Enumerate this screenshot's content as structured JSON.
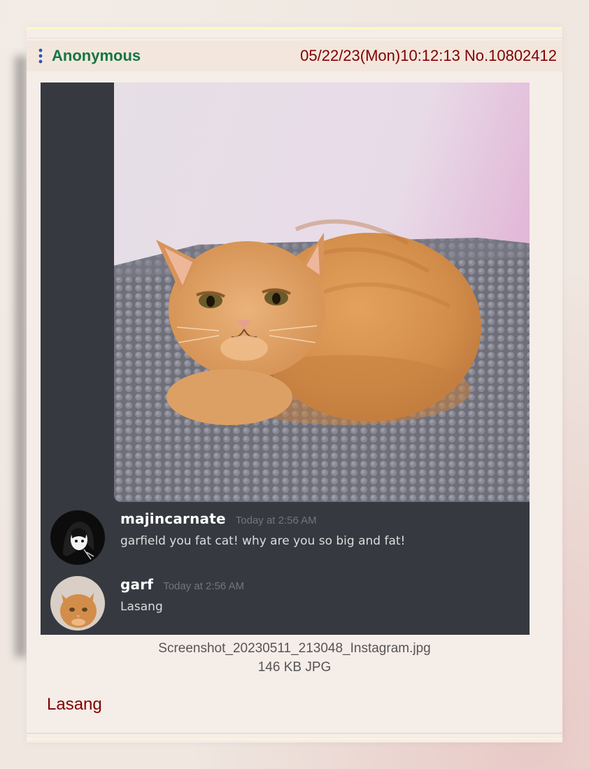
{
  "post": {
    "author": "Anonymous",
    "datetime": "05/22/23(Mon)10:12:13",
    "number": "No.10802412",
    "comment": "Lasang",
    "menu_icon": "vertical-ellipsis-icon"
  },
  "attachment": {
    "filename": "Screenshot_20230511_213048_Instagram.jpg",
    "filesize": "146 KB JPG"
  },
  "embedded_chat": {
    "messages": [
      {
        "username": "majincarnate",
        "timestamp": "Today at 2:56 AM",
        "text": "garfield you fat cat! why are you so big and fat!"
      },
      {
        "username": "garf",
        "timestamp": "Today at 2:56 AM",
        "text": "Lasang"
      }
    ]
  },
  "colors": {
    "name_green": "#117743",
    "meta_maroon": "#800000",
    "post_bg": "#f3e6dd",
    "chat_bg": "#36393f"
  }
}
